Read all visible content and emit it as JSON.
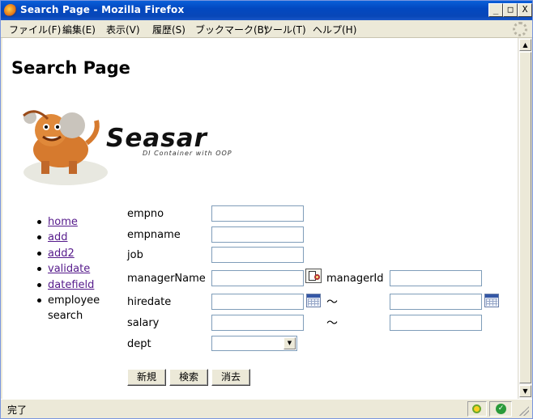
{
  "window": {
    "title": "Search Page - Mozilla Firefox",
    "min_label": "_",
    "max_label": "□",
    "close_label": "X"
  },
  "menu": [
    "ファイル(F)",
    "編集(E)",
    "表示(V)",
    "履歴(S)",
    "ブックマーク(B)",
    "ツール(T)",
    "ヘルプ(H)"
  ],
  "page": {
    "title": "Search Page",
    "logo": {
      "wordmark": "Seasar",
      "tagline": "DI Container with OOP"
    }
  },
  "nav": {
    "items": [
      {
        "label": "home",
        "link": true
      },
      {
        "label": "add",
        "link": true
      },
      {
        "label": "add2",
        "link": true
      },
      {
        "label": "validate",
        "link": true
      },
      {
        "label": "datefield",
        "link": true
      },
      {
        "label": "employee search",
        "link": false
      }
    ]
  },
  "form": {
    "empno": {
      "label": "empno",
      "value": ""
    },
    "empname": {
      "label": "empname",
      "value": ""
    },
    "job": {
      "label": "job",
      "value": ""
    },
    "managerName": {
      "label": "managerName",
      "value": ""
    },
    "managerId": {
      "label": "managerId",
      "value": ""
    },
    "hiredate": {
      "label": "hiredate",
      "from": "",
      "to": ""
    },
    "salary": {
      "label": "salary",
      "from": "",
      "to": ""
    },
    "dept": {
      "label": "dept",
      "selected": ""
    },
    "range_sep": "～",
    "buttons": {
      "new": "新規",
      "search": "検索",
      "clear": "消去"
    }
  },
  "status": {
    "text": "完了",
    "ok_glyph": "✓"
  },
  "scroll": {
    "up": "▲",
    "down": "▼",
    "select_arrow": "▼"
  }
}
